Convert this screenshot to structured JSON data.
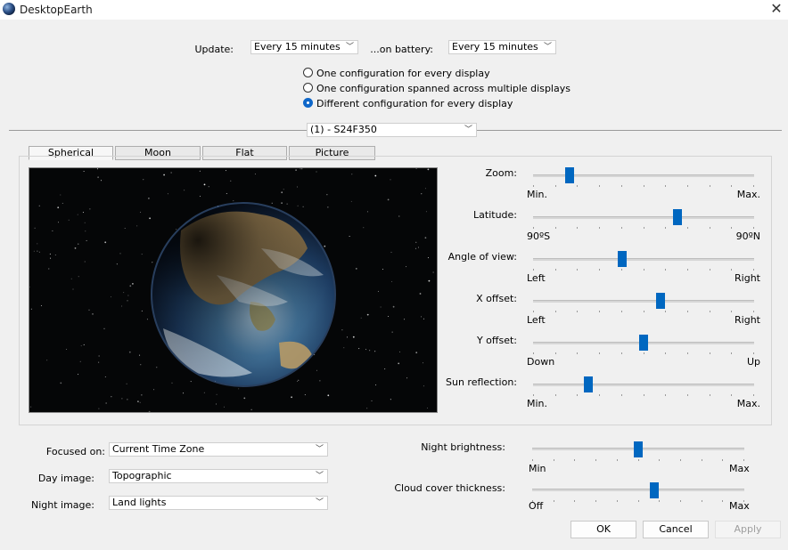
{
  "window": {
    "title": "DesktopEarth"
  },
  "update": {
    "label": "Update:",
    "value": "Every 15 minutes",
    "battery_label": "...on battery:",
    "battery_value": "Every 15 minutes"
  },
  "config": {
    "options": [
      {
        "label": "One configuration for every display",
        "selected": false
      },
      {
        "label": "One configuration spanned across multiple displays",
        "selected": false
      },
      {
        "label": "Different configuration for every display",
        "selected": true
      }
    ],
    "display": "(1) - S24F350"
  },
  "tabs": [
    {
      "label": "Spherical",
      "active": true
    },
    {
      "label": "Moon",
      "active": false
    },
    {
      "label": "Flat",
      "active": false
    },
    {
      "label": "Picture",
      "active": false
    }
  ],
  "sliders": [
    {
      "label": "Zoom:",
      "min_label": "Min.",
      "max_label": "Max.",
      "value": 0.15
    },
    {
      "label": "Latitude:",
      "min_label": "90ºS",
      "max_label": "90ºN",
      "value": 0.66
    },
    {
      "label": "Angle of view:",
      "min_label": "Left",
      "max_label": "Right",
      "value": 0.4
    },
    {
      "label": "X offset:",
      "min_label": "Left",
      "max_label": "Right",
      "value": 0.58
    },
    {
      "label": "Y offset:",
      "min_label": "Down",
      "max_label": "Up",
      "value": 0.5
    },
    {
      "label": "Sun reflection:",
      "min_label": "Min.",
      "max_label": "Max.",
      "value": 0.24
    }
  ],
  "bottom": {
    "focused_label": "Focused on:",
    "focused_value": "Current Time Zone",
    "day_label": "Day image:",
    "day_value": "Topographic",
    "night_label": "Night image:",
    "night_value": "Land lights",
    "night_brightness": {
      "label": "Night brightness:",
      "min_label": "Min",
      "max_label": "Max",
      "value": 0.5
    },
    "cloud_cover": {
      "label": "Cloud cover thickness:",
      "min_label": "Off",
      "max_label": "Max",
      "value": 0.58
    }
  },
  "buttons": {
    "ok": "OK",
    "cancel": "Cancel",
    "apply": "Apply"
  },
  "colors": {
    "accent": "#0067c0",
    "space": "#050607"
  },
  "icons": {
    "app": "earth-icon",
    "close": "close-icon",
    "dropdown": "chevron-down-icon"
  }
}
